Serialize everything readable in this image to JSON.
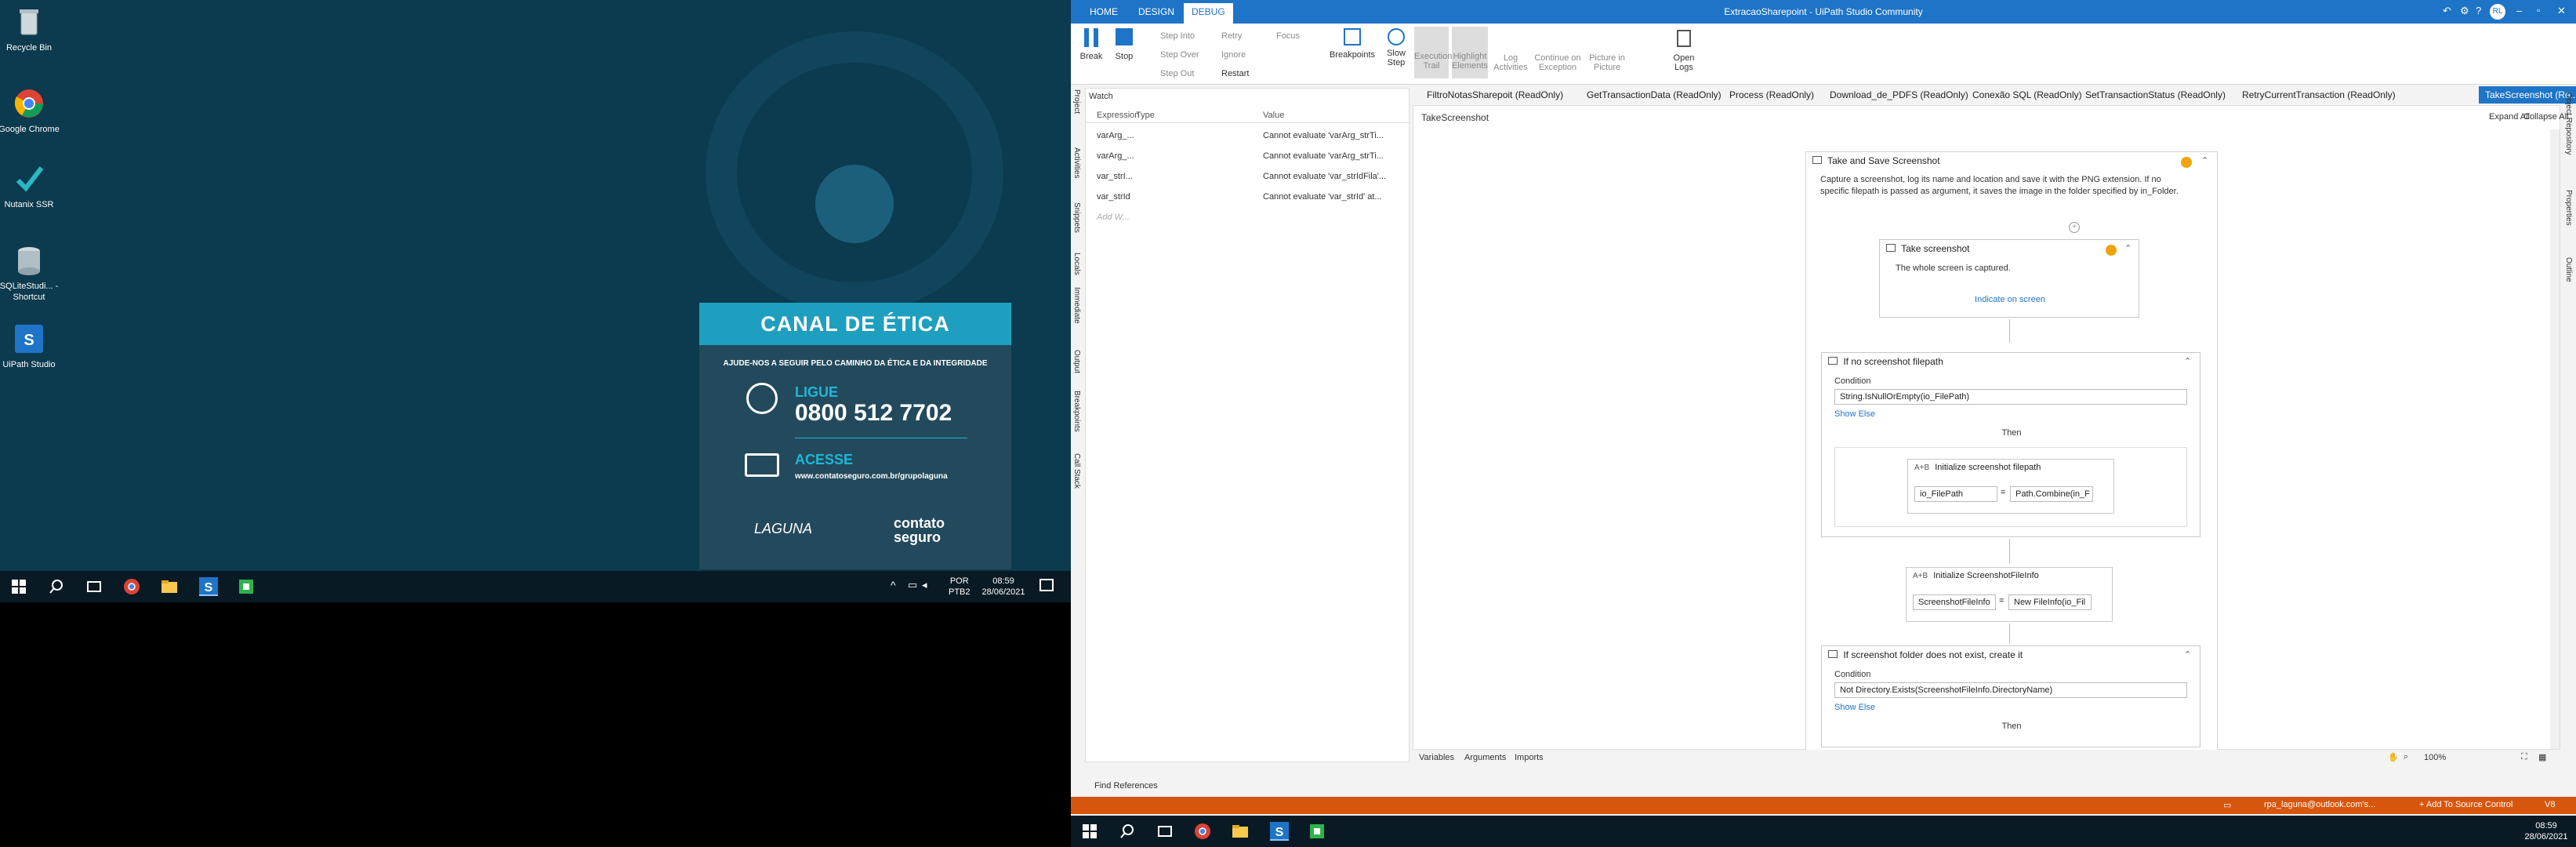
{
  "desktop": {
    "icons": [
      {
        "label": "Recycle Bin"
      },
      {
        "label": "Google Chrome"
      },
      {
        "label": "Nutanix SSR"
      },
      {
        "label": "SQLiteStudi... - Shortcut"
      },
      {
        "label": "UiPath Studio"
      }
    ],
    "poster": {
      "title": "CANAL DE ÉTICA",
      "tagline": "AJUDE-NOS A SEGUIR PELO CAMINHO DA ÉTICA E DA INTEGRIDADE",
      "phone_label": "LIGUE",
      "phone": "0800 512 7702",
      "web_label": "ACESSE",
      "url": "www.contatoseguro.com.br/grupolaguna",
      "logo1": "LAGUNA",
      "logo2": "contato seguro"
    },
    "taskbar": {
      "lang": "POR",
      "layout": "PTB2",
      "time": "08:59",
      "date": "28/06/2021"
    }
  },
  "studio": {
    "title": "ExtracaoSharepoint - UiPath Studio Community",
    "user_initials": "RL",
    "ribbon_tabs": [
      "HOME",
      "DESIGN",
      "DEBUG"
    ],
    "ribbon": {
      "break": "Break",
      "stop": "Stop",
      "step_into": "Step Into",
      "step_over": "Step Over",
      "step_out": "Step Out",
      "retry": "Retry",
      "ignore": "Ignore",
      "restart": "Restart",
      "focus": "Focus",
      "breakpoints": "Breakpoints",
      "slow_step": "Slow Step",
      "execution_trail": "Execution Trail",
      "highlight_elements": "Highlight Elements",
      "log_activities": "Log Activities",
      "continue_on_exception": "Continue on Exception",
      "picture_in_picture": "Picture in Picture",
      "open_logs": "Open Logs"
    },
    "side_tabs": [
      "Project",
      "Activities",
      "Snippets",
      "Locals",
      "Immediate",
      "Output",
      "Breakpoints",
      "Call Stack"
    ],
    "right_side_tabs": [
      "Object Repository",
      "Properties",
      "Outline"
    ],
    "watch": {
      "title": "Watch",
      "headers": [
        "Expression",
        "Type",
        "Value"
      ],
      "rows": [
        {
          "expr": "varArg_...",
          "type": "",
          "value": "Cannot evaluate 'varArg_strTi..."
        },
        {
          "expr": "varArg_...",
          "type": "",
          "value": "Cannot evaluate 'varArg_strTi..."
        },
        {
          "expr": "var_strI...",
          "type": "",
          "value": "Cannot evaluate 'var_strIdFila'..."
        },
        {
          "expr": "var_strId",
          "type": "",
          "value": "Cannot evaluate 'var_strId' at..."
        }
      ],
      "add_placeholder": "Add W..."
    },
    "doc_tabs": [
      "FiltroNotasSharepoit (ReadOnly)",
      "GetTransactionData (ReadOnly)",
      "Process (ReadOnly)",
      "Download_de_PDFS (ReadOnly)",
      "Conexão SQL (ReadOnly)",
      "SetTransactionStatus (ReadOnly)",
      "RetryCurrentTransaction (ReadOnly)",
      "TakeScreenshot (Re..."
    ],
    "breadcrumb": "TakeScreenshot",
    "expand_all": "Expand All",
    "collapse_all": "Collapse All",
    "workflow": {
      "outer_title": "Take and Save Screenshot",
      "outer_desc": "Capture a screenshot, log its name and location and save it with the PNG extension. If no specific filepath is passed as argument, it saves the image in the folder specified by in_Folder.",
      "take_title": "Take screenshot",
      "take_desc": "The whole screen is captured.",
      "indicate": "Indicate on screen",
      "if1_title": "If no screenshot filepath",
      "condition_label": "Condition",
      "if1_condition": "String.IsNullOrEmpty(io_FilePath)",
      "show_else": "Show Else",
      "then_label": "Then",
      "assign1_title": "Initialize screenshot filepath",
      "assign1_to": "io_FilePath",
      "assign1_value": "Path.Combine(in_F",
      "assign2_title": "Initialize ScreenshotFileInfo",
      "assign2_to": "ScreenshotFileInfo",
      "assign2_value": "New FileInfo(io_Fil",
      "if2_title": "If screenshot folder does not exist, create it",
      "if2_condition": "Not Directory.Exists(ScreenshotFileInfo.DirectoryName)"
    },
    "bottom_tabs": [
      "Variables",
      "Arguments",
      "Imports"
    ],
    "zoom": "100%",
    "find_references": "Find References",
    "status": {
      "account": "rpa_laguna@outlook.com's...",
      "source_control": "+ Add To Source Control",
      "version": "V8"
    },
    "taskbar": {
      "time": "08:59",
      "date": "28/06/2021"
    },
    "colors": {
      "accent": "#1e74c6",
      "status": "#d7560e",
      "warning": "#f0a30a"
    }
  }
}
